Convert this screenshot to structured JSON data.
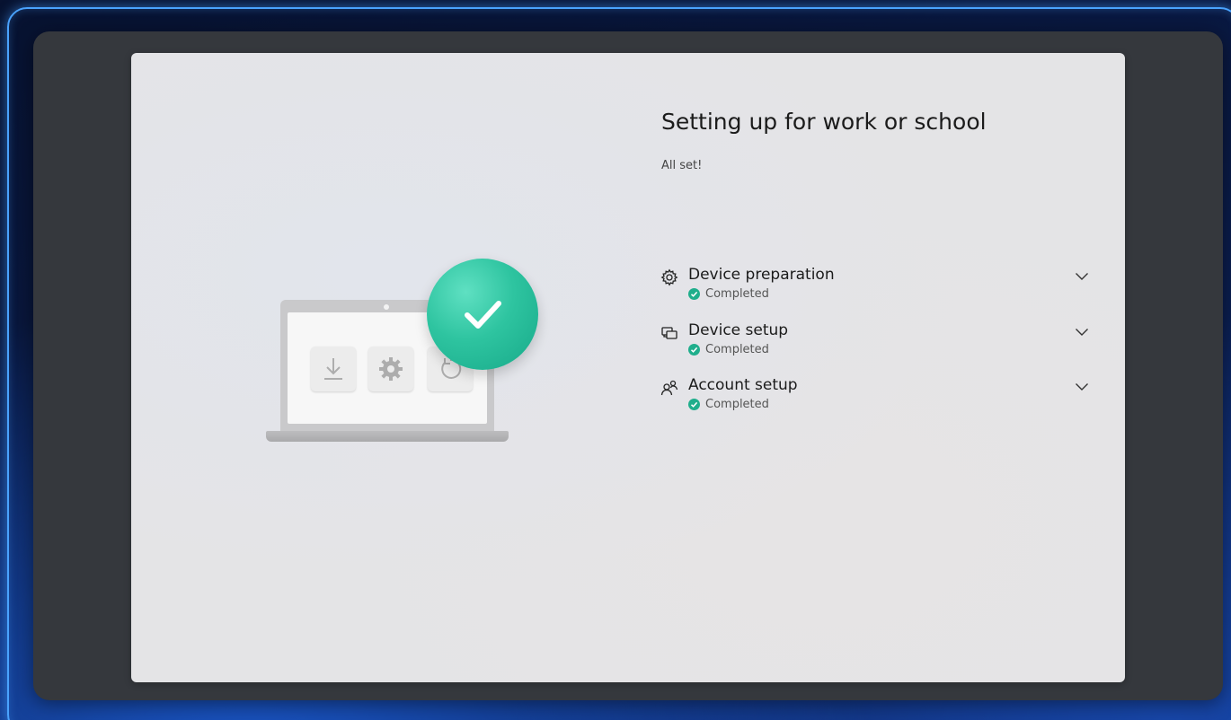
{
  "page": {
    "title": "Setting up for work or school",
    "subtitle": "All set!"
  },
  "steps": [
    {
      "label": "Device preparation",
      "status": "Completed",
      "icon": "gear-icon"
    },
    {
      "label": "Device setup",
      "status": "Completed",
      "icon": "device-setup-icon"
    },
    {
      "label": "Account setup",
      "status": "Completed",
      "icon": "people-icon"
    }
  ],
  "illustration": {
    "tiles": [
      "download-icon",
      "gear-icon",
      "refresh-icon"
    ],
    "badge": "checkmark-icon"
  },
  "colors": {
    "accent": "#2ec4a0",
    "status_completed": "#1fae8c",
    "panel": "#e4e4e6",
    "frame": "#35383d"
  }
}
